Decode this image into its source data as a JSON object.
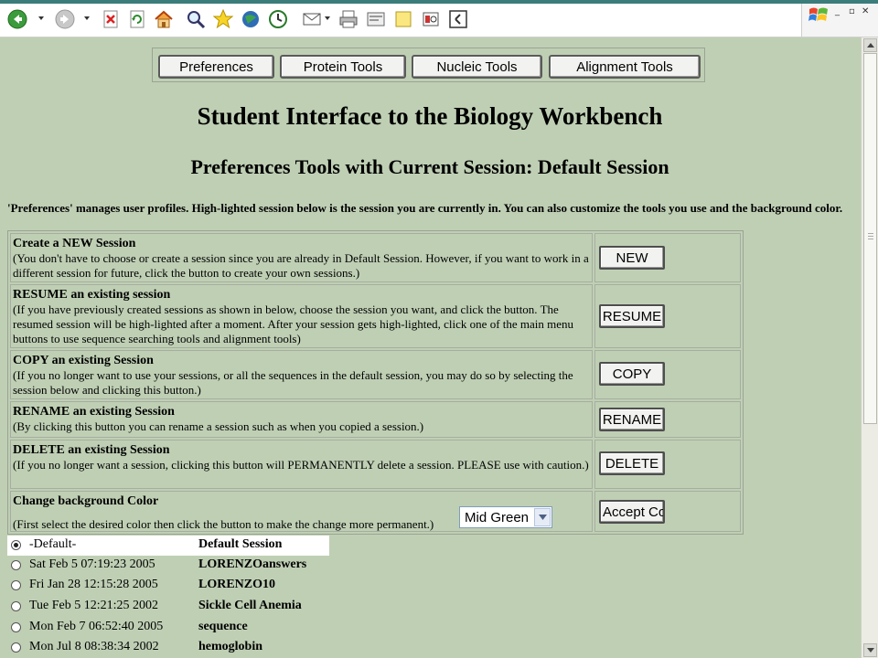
{
  "toolbar": {
    "icons": [
      "back-icon",
      "forward-icon",
      "stop-icon",
      "refresh-icon",
      "home-icon",
      "search-icon",
      "favorites-icon",
      "media-icon",
      "history-icon",
      "mail-icon",
      "print-icon",
      "edit-icon",
      "discuss-icon",
      "research-icon",
      "messenger-icon"
    ]
  },
  "nav": {
    "buttons": [
      "Preferences",
      "Protein Tools",
      "Nucleic Tools",
      "Alignment Tools"
    ]
  },
  "page": {
    "title": "Student Interface to the Biology Workbench",
    "subtitle": "Preferences Tools with Current Session: Default Session",
    "intro": "'Preferences' manages user profiles.   High-lighted session below is the session you are currently in. You can also customize the tools you use and the background color."
  },
  "actions": [
    {
      "title": "Create a NEW Session",
      "desc": "(You don't have to choose or create a session since you are already in Default Session. However, if you want to work in a different session for future, click the button to create your own sessions.)",
      "button": "NEW"
    },
    {
      "title": "RESUME an existing session",
      "desc": "(If you have previously created sessions as shown in below, choose the session you want, and click the button. The resumed session will be high-lighted after a moment. After your session gets high-lighted, click one of the main menu buttons to use sequence searching tools and alignment tools)",
      "button": "RESUME"
    },
    {
      "title": "COPY an existing Session",
      "desc": "(If you no longer want to use your sessions, or all the sequences in the default session, you may do so by selecting the session below and clicking this button.)",
      "button": "COPY"
    },
    {
      "title": "RENAME an existing Session",
      "desc": "(By clicking this button you can rename a session such as when you copied a session.)",
      "button": "RENAME"
    },
    {
      "title": "DELETE an existing Session",
      "desc": "(If you no longer want a session, clicking this button will PERMANENTLY delete a session. PLEASE use with caution.)",
      "button": "DELETE"
    },
    {
      "title": "Change background Color",
      "desc": "(First select the desired color then click the button to make the change more permanent.)",
      "button": "Accept Co"
    }
  ],
  "color_select": {
    "value": "Mid Green"
  },
  "sessions": [
    {
      "date": "-Default-",
      "name": "Default Session",
      "selected": true
    },
    {
      "date": "Sat Feb 5 07:19:23 2005",
      "name": "LORENZOanswers",
      "selected": false
    },
    {
      "date": "Fri Jan 28 12:15:28 2005",
      "name": "LORENZO10",
      "selected": false
    },
    {
      "date": "Tue Feb 5 12:21:25 2002",
      "name": "Sickle Cell Anemia",
      "selected": false
    },
    {
      "date": "Mon Feb 7 06:52:40 2005",
      "name": "sequence",
      "selected": false
    },
    {
      "date": "Mon Jul 8 08:38:34 2002",
      "name": "hemoglobin",
      "selected": false
    }
  ],
  "colors": {
    "background": "#bfcfb4",
    "accent": "#3b7d7b"
  }
}
